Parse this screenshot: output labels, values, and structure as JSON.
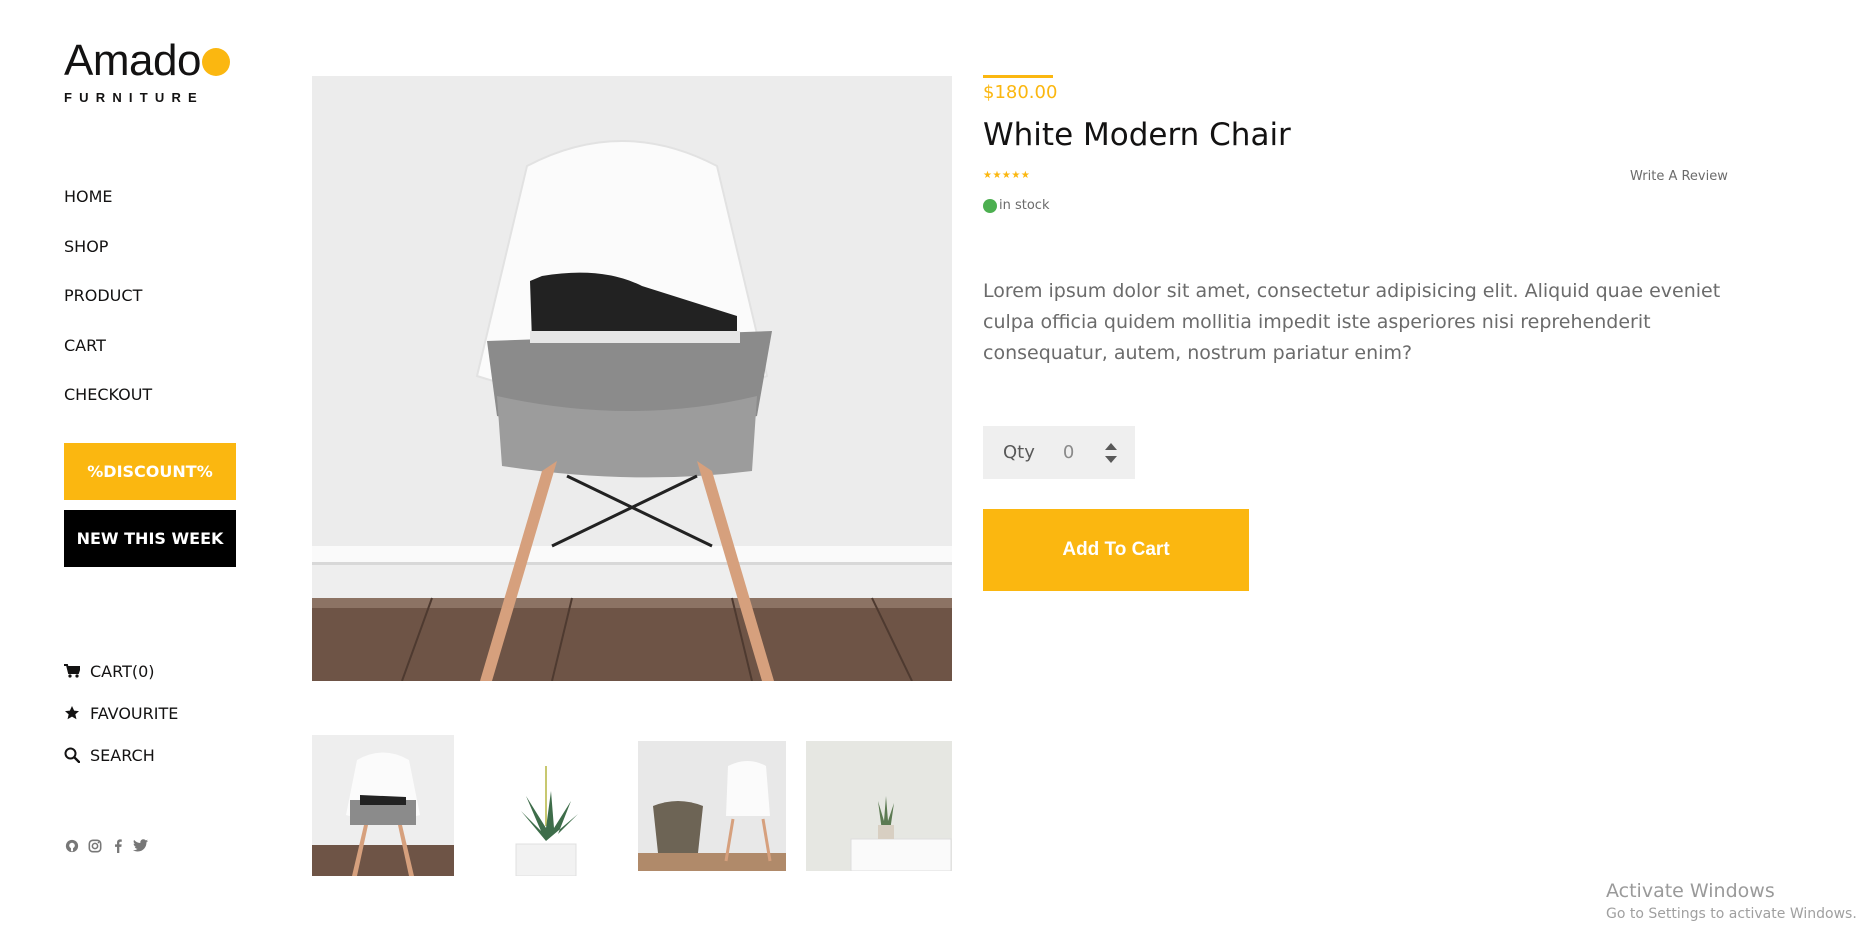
{
  "brand": {
    "name": "Amado",
    "tagline": "FURNITURE",
    "accent_color": "#fbb710"
  },
  "nav": [
    {
      "label": "HOME"
    },
    {
      "label": "SHOP"
    },
    {
      "label": "PRODUCT"
    },
    {
      "label": "CART"
    },
    {
      "label": "CHECKOUT"
    }
  ],
  "sidebar_buttons": {
    "discount": "%DISCOUNT%",
    "new_this_week": "NEW THIS WEEK"
  },
  "sidebar_tools": [
    {
      "icon": "cart-icon",
      "label": "CART(0)"
    },
    {
      "icon": "star-icon",
      "label": "FAVOURITE"
    },
    {
      "icon": "search-icon",
      "label": "SEARCH"
    }
  ],
  "social": [
    "github-icon",
    "instagram-icon",
    "facebook-icon",
    "twitter-icon"
  ],
  "product": {
    "price": "$180.00",
    "name": "White Modern Chair",
    "rating_stars": "★★★★★",
    "review_link": "Write A Review",
    "stock": "in stock",
    "description": "Lorem ipsum dolor sit amet, consectetur adipisicing elit. Aliquid quae eveniet culpa officia quidem mollitia impedit iste asperiores nisi reprehenderit consequatur, autem, nostrum pariatur enim?",
    "qty_label": "Qty",
    "qty_value": "0",
    "add_to_cart": "Add To Cart"
  },
  "watermark": {
    "title": "Activate Windows",
    "subtitle": "Go to Settings to activate Windows."
  }
}
